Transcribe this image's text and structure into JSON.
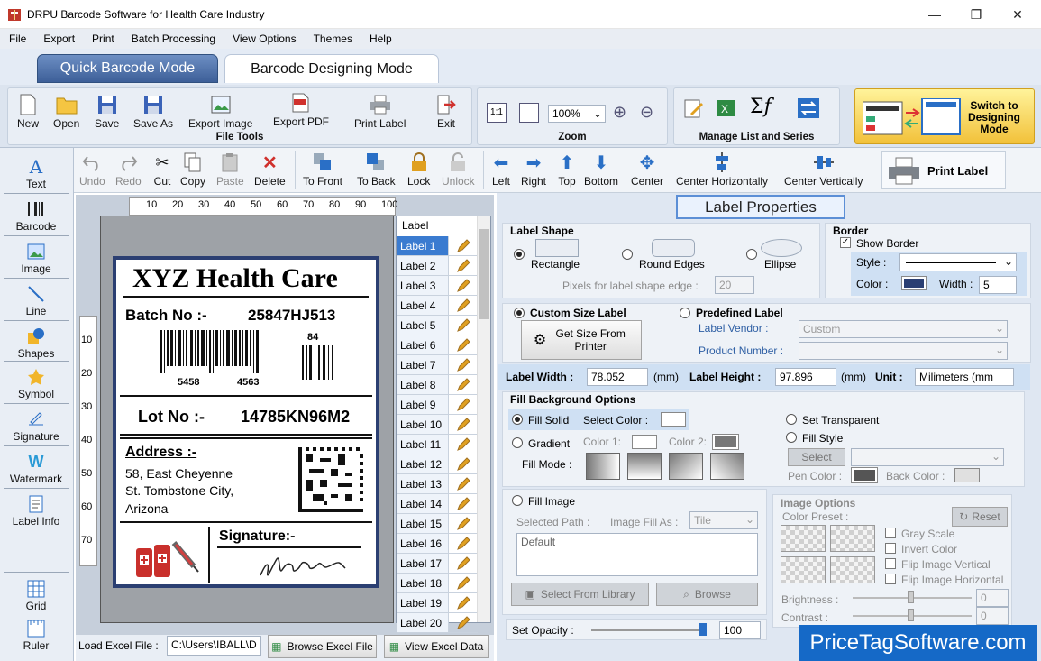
{
  "window": {
    "title": "DRPU Barcode Software for Health Care Industry",
    "minimize": "—",
    "maximize": "❐",
    "close": "✕"
  },
  "menu": [
    "File",
    "Export",
    "Print",
    "Batch Processing",
    "View Options",
    "Themes",
    "Help"
  ],
  "modes": {
    "quick": "Quick Barcode Mode",
    "design": "Barcode Designing Mode"
  },
  "file_tools": {
    "label": "File Tools",
    "buttons": [
      "New",
      "Open",
      "Save",
      "Save As",
      "Export Image",
      "Export PDF",
      "Print Label",
      "Exit"
    ]
  },
  "zoom": {
    "label": "Zoom",
    "value": "100%"
  },
  "manage": {
    "label": "Manage List and Series"
  },
  "switch": {
    "label": "Switch to Designing Mode"
  },
  "left_tools": [
    "Text",
    "Barcode",
    "Image",
    "Line",
    "Shapes",
    "Symbol",
    "Signature",
    "Watermark",
    "Label Info",
    "Grid",
    "Ruler"
  ],
  "edit_tools": [
    "Undo",
    "Redo",
    "Cut",
    "Copy",
    "Paste",
    "Delete",
    "To Front",
    "To Back",
    "Lock",
    "Unlock",
    "Left",
    "Right",
    "Top",
    "Bottom",
    "Center",
    "Center Horizontally",
    "Center Vertically"
  ],
  "print_label": "Print Label",
  "ruler": {
    "h": [
      "10",
      "20",
      "30",
      "40",
      "50",
      "60",
      "70",
      "80",
      "90",
      "100"
    ],
    "v": [
      "10",
      "20",
      "30",
      "40",
      "50",
      "60",
      "70"
    ]
  },
  "label": {
    "company": "XYZ Health Care",
    "batch_label": "Batch No :-",
    "batch_value": "25847HJ513",
    "bc_left": "5458",
    "bc_right": "4563",
    "bc_small": "84",
    "lot_label": "Lot No :-",
    "lot_value": "14785KN96M2",
    "address_label": "Address :-",
    "address_lines": [
      "58, East Cheyenne",
      "St. Tombstone City,",
      "Arizona"
    ],
    "signature_label": "Signature:-"
  },
  "label_list": {
    "header": "Label",
    "items": [
      "Label 1",
      "Label 2",
      "Label 3",
      "Label 4",
      "Label 5",
      "Label 6",
      "Label 7",
      "Label 8",
      "Label 9",
      "Label 10",
      "Label 11",
      "Label 12",
      "Label 13",
      "Label 14",
      "Label 15",
      "Label 16",
      "Label 17",
      "Label 18",
      "Label 19",
      "Label 20"
    ]
  },
  "bottom": {
    "load_excel": "Load Excel File :",
    "excel_path": "C:\\Users\\IBALL\\D",
    "browse_excel": "Browse Excel File",
    "view_excel": "View Excel Data"
  },
  "props": {
    "title": "Label Properties",
    "label_shape": "Label Shape",
    "rectangle": "Rectangle",
    "round_edges": "Round Edges",
    "ellipse": "Ellipse",
    "pixels_edge": "Pixels for label shape edge :",
    "pixels_value": "20",
    "border": "Border",
    "show_border": "Show Border",
    "style": "Style :",
    "color": "Color :",
    "width_label": "Width :",
    "width_value": "5",
    "border_color": "#2b3f72",
    "custom_size": "Custom Size Label",
    "get_size": "Get Size From Printer",
    "predefined": "Predefined Label",
    "vendor_label": "Label Vendor :",
    "vendor_value": "Custom",
    "product_label": "Product Number :",
    "label_width": "Label Width :",
    "width_val": "78.052",
    "mm1": "(mm)",
    "label_height": "Label Height :",
    "height_val": "97.896",
    "mm2": "(mm)",
    "unit": "Unit :",
    "unit_val": "Milimeters (mm",
    "fill_bg": "Fill Background Options",
    "fill_solid": "Fill Solid",
    "select_color": "Select Color :",
    "set_transparent": "Set Transparent",
    "gradient": "Gradient",
    "color1": "Color 1:",
    "color2": "Color 2:",
    "fill_style": "Fill Style",
    "select": "Select",
    "fill_mode": "Fill Mode :",
    "pen_color": "Pen Color :",
    "back_color": "Back Color :",
    "fill_image": "Fill Image",
    "selected_path": "Selected Path :",
    "image_fill_as": "Image Fill As :",
    "tile": "Tile",
    "default_text": "Default",
    "select_library": "Select From Library",
    "browse": "Browse",
    "image_options": "Image Options",
    "color_preset": "Color Preset :",
    "reset": "Reset",
    "gray_scale": "Gray Scale",
    "invert": "Invert Color",
    "flip_v": "Flip Image Vertical",
    "flip_h": "Flip Image Horizontal",
    "brightness": "Brightness :",
    "brightness_val": "0",
    "contrast": "Contrast :",
    "contrast_val": "0",
    "opacity": "Set Opacity :",
    "opacity_val": "100"
  },
  "watermark": "PriceTagSoftware.com"
}
